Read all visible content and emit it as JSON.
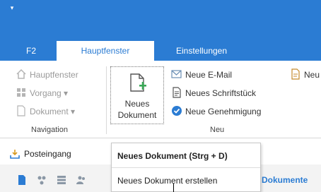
{
  "titlebar": {
    "quick_access": "▾"
  },
  "tabs": [
    {
      "label": "F2"
    },
    {
      "label": "Hauptfenster"
    },
    {
      "label": "Einstellungen"
    }
  ],
  "navigation": {
    "items": [
      "Hauptfenster",
      "Vorgang ▾",
      "Dokument ▾"
    ],
    "group_label": "Navigation"
  },
  "neu": {
    "new_document": "Neues Dokument",
    "new_document_line1": "Neues",
    "new_document_line2": "Dokument",
    "new_email": "Neue E-Mail",
    "new_document_written": "Neues Schriftstück",
    "new_approval": "Neue Genehmigung",
    "more_truncated": "Neu",
    "group_label": "Neu"
  },
  "inbox": {
    "label": "Posteingang"
  },
  "toolbar2": {
    "documents_label": "Dokumente"
  },
  "tooltip": {
    "title": "Neues Dokument (Strg + D)",
    "description": "Neues Dokument erstellen"
  },
  "colors": {
    "accent": "#2b7cd3",
    "green": "#3aa856"
  }
}
